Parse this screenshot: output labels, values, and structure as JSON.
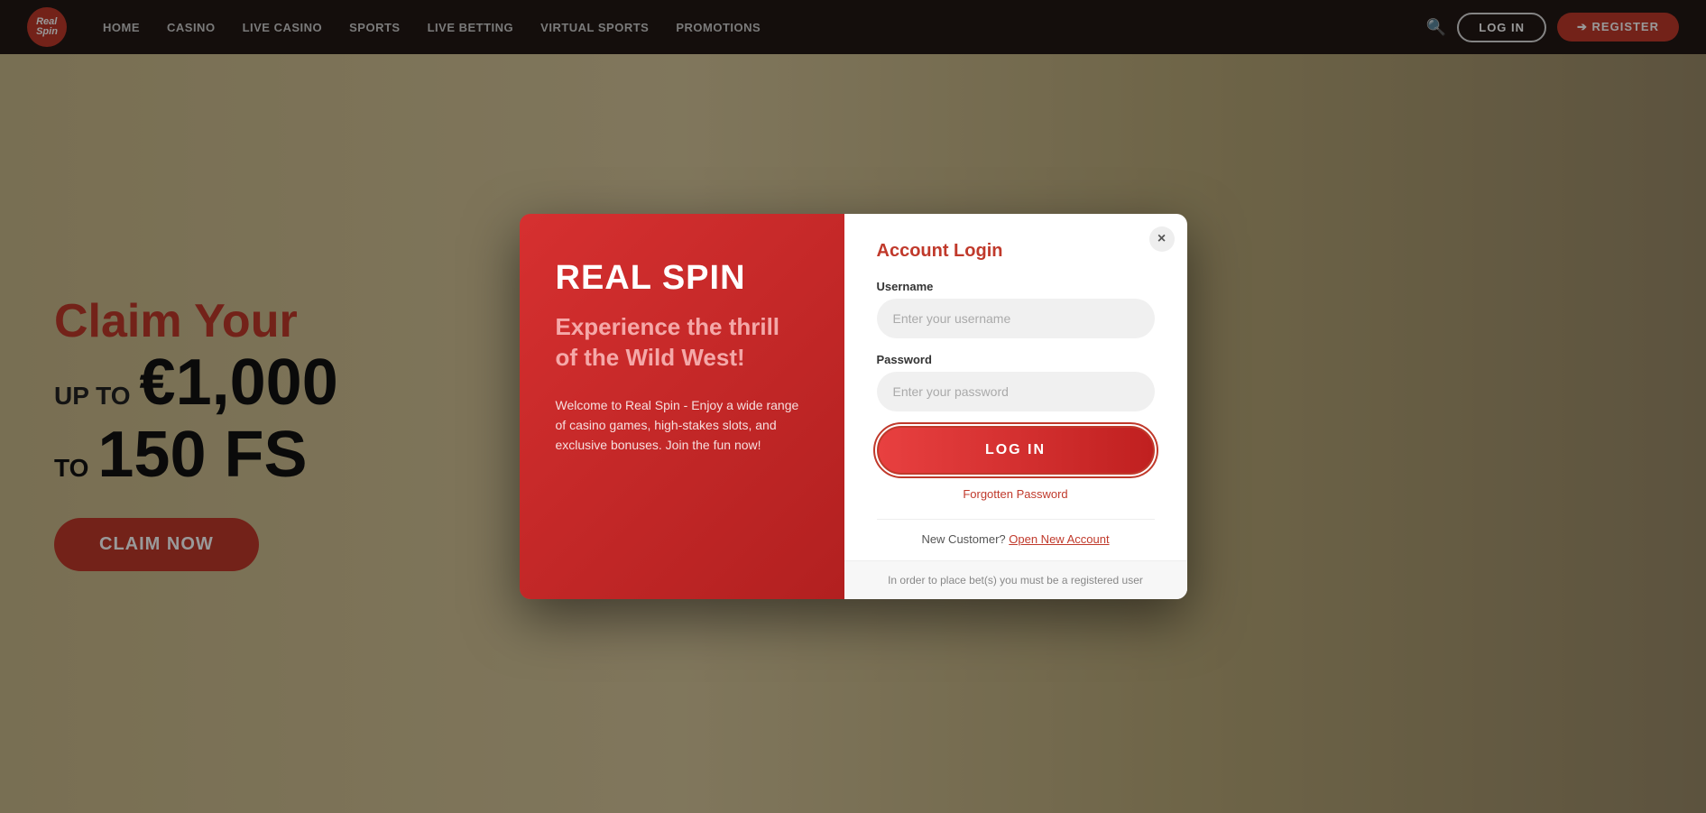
{
  "nav": {
    "logo_text": "Real Spin",
    "links": [
      "Home",
      "Casino",
      "Live Casino",
      "Sports",
      "Live Betting",
      "Virtual Sports",
      "Promotions"
    ],
    "login_label": "LOG IN",
    "register_label": "➔ REGISTER"
  },
  "hero": {
    "claim_line": "Claim Your",
    "up_to": "UP TO",
    "amount": "€1,000",
    "free_spins_prefix": "TO",
    "free_spins": "150 FS",
    "cta_label": "CLAIM NOW"
  },
  "modal": {
    "close_icon": "×",
    "left": {
      "title": "REAL SPIN",
      "tagline": "Experience the thrill of the Wild West!",
      "description": "Welcome to Real Spin - Enjoy a wide range of casino games, high-stakes slots, and exclusive bonuses. Join the fun now!"
    },
    "right": {
      "title": "Account Login",
      "username_label": "Username",
      "username_placeholder": "Enter your username",
      "password_label": "Password",
      "password_placeholder": "Enter your password",
      "login_button": "LOG IN",
      "forgotten_pw": "Forgotten Password",
      "new_customer_text": "New Customer?",
      "open_account_label": "Open New Account",
      "footer_note": "In order to place bet(s) you must be a registered user"
    }
  }
}
